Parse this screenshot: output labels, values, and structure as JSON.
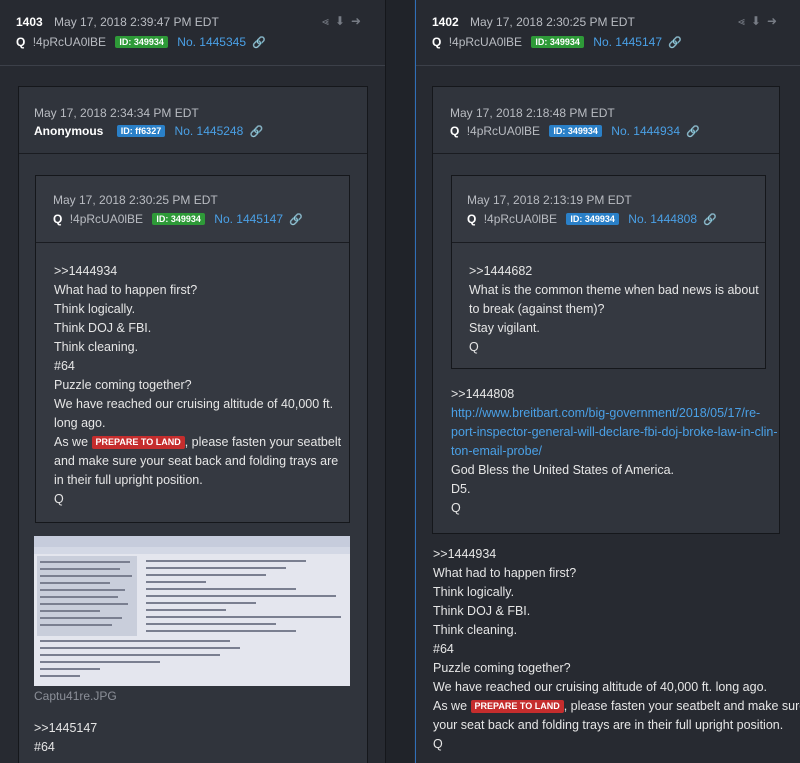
{
  "left": {
    "header": {
      "num": "1403",
      "time": "May 17, 2018 2:39:47 PM EDT",
      "q": "Q",
      "trip": "!4pRcUA0lBE",
      "id": "ID: 349934",
      "post_no": "No. 1445345",
      "link_icon": "🔗",
      "actions": "≺ ⬇ ➜"
    },
    "outer": {
      "time": "May 17, 2018 2:34:34 PM EDT",
      "name": "Anonymous",
      "id": "ID: ff6327",
      "post_no": "No. 1445248"
    },
    "inner": {
      "time": "May 17, 2018 2:30:25 PM EDT",
      "q": "Q",
      "trip": "!4pRcUA0lBE",
      "id": "ID: 349934",
      "post_no": "No. 1445147",
      "lines": [
        ">>1444934",
        "What had to happen first?",
        "Think logically.",
        "Think DOJ & FBI.",
        "Think cleaning.",
        "#64",
        "Puzzle coming together?",
        "We have reached our cruising altitude of 40,000 ft.",
        "long ago."
      ],
      "pre_badge": "As we",
      "badge": "PREPARE TO LAND",
      "post_badge": ", please fasten your seatbelt",
      "lines2": [
        "and make sure your seat back and folding trays are",
        "in their full upright position.",
        "Q"
      ]
    },
    "attachment": {
      "caption": "Captu41re.JPG"
    },
    "bottom_lines": [
      ">>1445147",
      "#64"
    ]
  },
  "right": {
    "header": {
      "num": "1402",
      "time": "May 17, 2018 2:30:25 PM EDT",
      "q": "Q",
      "trip": "!4pRcUA0lBE",
      "id": "ID: 349934",
      "post_no": "No. 1445147",
      "link_icon": "🔗",
      "actions": "≺ ⬇ ➜"
    },
    "outer": {
      "time": "May 17, 2018 2:18:48 PM EDT",
      "q": "Q",
      "trip": "!4pRcUA0lBE",
      "id": "ID: 349934",
      "post_no": "No. 1444934"
    },
    "inner": {
      "time": "May 17, 2018 2:13:19 PM EDT",
      "q": "Q",
      "trip": "!4pRcUA0lBE",
      "id": "ID: 349934",
      "post_no": "No. 1444808",
      "lines": [
        ">>1444682",
        "What is the common theme when bad news is about",
        "to break (against them)?",
        "Stay vigilant.",
        "Q"
      ]
    },
    "outer_body": {
      "ref": ">>1444808",
      "url_lines": [
        "http://www.breitbart.com/big-government/2018/05/17/re-",
        "port-inspector-general-will-declare-fbi-doj-broke-law-in-clin-",
        "ton-email-probe/"
      ],
      "lines": [
        "God Bless the United States of America.",
        "D5.",
        "Q"
      ]
    },
    "body": {
      "lines": [
        ">>1444934",
        "What had to happen first?",
        "Think logically.",
        "Think DOJ & FBI.",
        "Think cleaning.",
        "#64",
        "Puzzle coming together?",
        "We have reached our cruising altitude of 40,000 ft. long ago."
      ],
      "pre_badge": "As we",
      "badge": "PREPARE TO LAND",
      "post_badge": ", please fasten your seatbelt and make sure",
      "lines2": [
        "your seat back and folding trays are in their full upright position.",
        "Q"
      ]
    }
  },
  "colors": {
    "background": "#272a31",
    "box": "#30343c",
    "link": "#4aa0e6",
    "id_green": "#2e9a38",
    "id_blue": "#2a80c8",
    "badge_red": "#c52d2d"
  }
}
